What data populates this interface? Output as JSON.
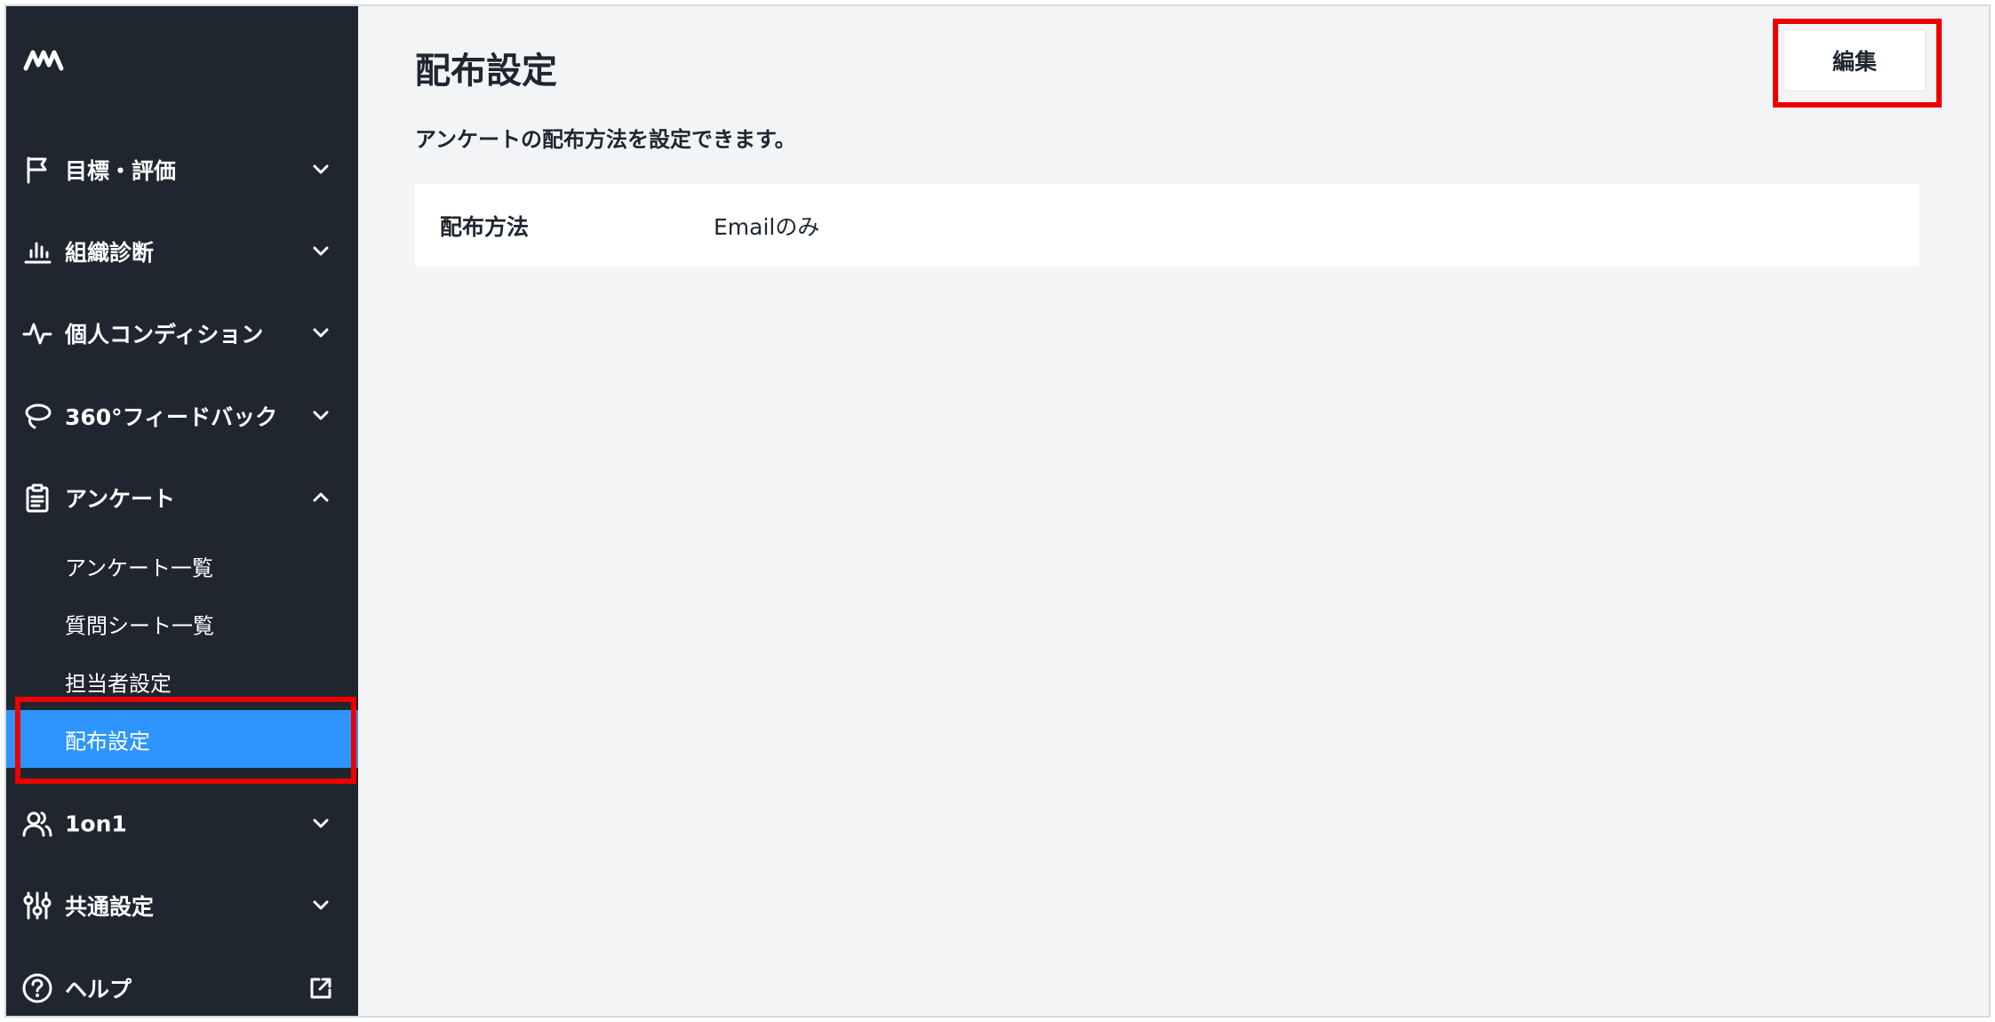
{
  "sidebar": {
    "nav": [
      {
        "label": "目標・評価",
        "icon": "flag-icon"
      },
      {
        "label": "組織診断",
        "icon": "bar-chart-icon"
      },
      {
        "label": "個人コンディション",
        "icon": "pulse-icon"
      },
      {
        "label": "360°フィードバック",
        "icon": "lasso-icon"
      },
      {
        "label": "アンケート",
        "icon": "clipboard-icon"
      }
    ],
    "survey_sub": [
      {
        "label": "アンケート一覧"
      },
      {
        "label": "質問シート一覧"
      },
      {
        "label": "担当者設定"
      },
      {
        "label": "配布設定",
        "active": true
      }
    ],
    "nav_bottom": [
      {
        "label": "1on1",
        "icon": "users-icon"
      },
      {
        "label": "共通設定",
        "icon": "sliders-icon"
      },
      {
        "label": "ヘルプ",
        "icon": "help-circle-icon"
      }
    ]
  },
  "main": {
    "title": "配布設定",
    "description": "アンケートの配布方法を設定できます。",
    "edit_label": "編集",
    "setting": {
      "label": "配布方法",
      "value": "Emailのみ"
    }
  },
  "colors": {
    "sidebar_bg": "#1f2630",
    "active_bg": "#2e95ff",
    "highlight": "#ee0000",
    "main_bg": "#f3f4f6"
  }
}
